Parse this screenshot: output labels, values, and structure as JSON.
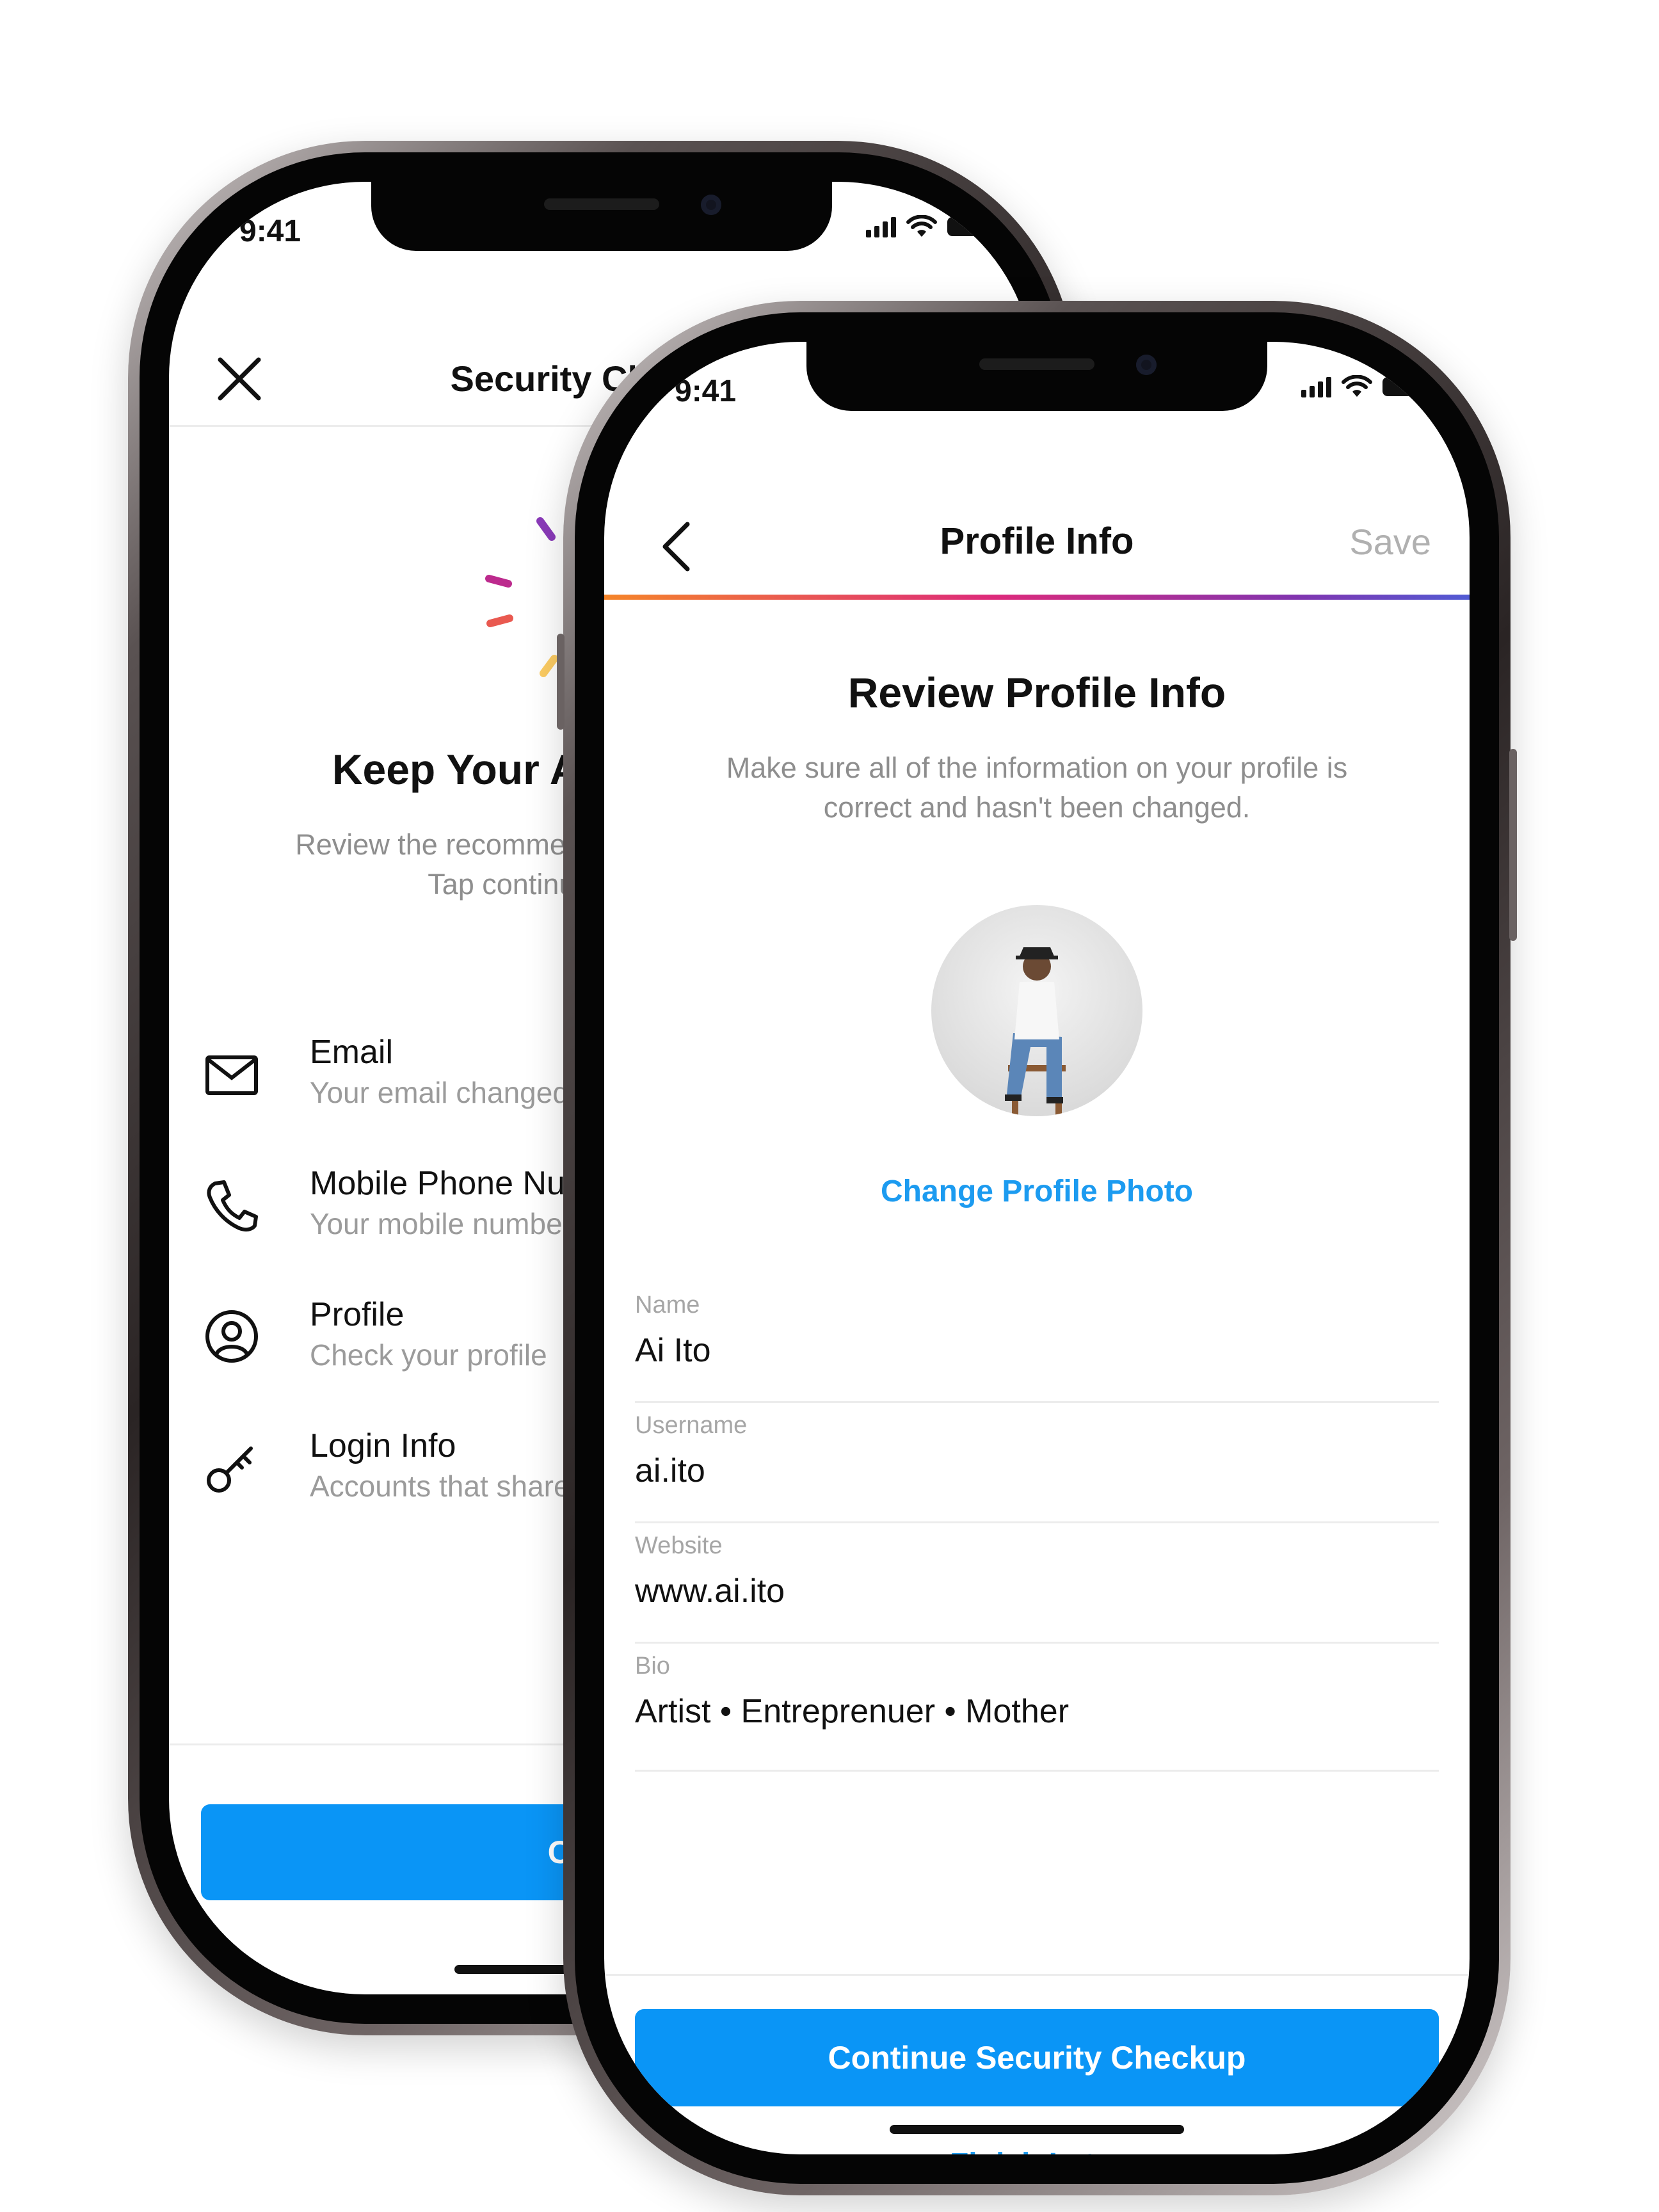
{
  "back_screen": {
    "status_time": "9:41",
    "nav_title": "Security Checkup",
    "headline": "Keep Your Account Secure",
    "subcopy": "Review the recommendations to protect your account. Tap continue and we'll guide you.",
    "items": [
      {
        "icon": "mail-icon",
        "title": "Email",
        "subtitle": "Your email changed"
      },
      {
        "icon": "phone-icon",
        "title": "Mobile Phone Number",
        "subtitle": "Your mobile number"
      },
      {
        "icon": "profile-icon",
        "title": "Profile",
        "subtitle": "Check your profile"
      },
      {
        "icon": "key-icon",
        "title": "Login Info",
        "subtitle": "Accounts that share"
      }
    ],
    "button_label": "Continue"
  },
  "front_screen": {
    "status_time": "9:41",
    "nav_title": "Profile Info",
    "save_label": "Save",
    "heading": "Review Profile Info",
    "description": "Make sure all of the information on your profile is correct and hasn't been changed.",
    "change_photo_label": "Change Profile Photo",
    "fields": [
      {
        "label": "Name",
        "value": "Ai Ito"
      },
      {
        "label": "Username",
        "value": "ai.ito"
      },
      {
        "label": "Website",
        "value": "www.ai.ito"
      },
      {
        "label": "Bio",
        "value": "Artist • Entreprenuer • Mother"
      }
    ],
    "continue_label": "Continue Security Checkup",
    "finish_later_label": "Finish Later"
  },
  "colors": {
    "accent_blue": "#0a95f6",
    "link_blue": "#1c9bf0",
    "progress_gradient": [
      "#f58529",
      "#dd2a7b",
      "#8134af",
      "#515bd4"
    ]
  }
}
